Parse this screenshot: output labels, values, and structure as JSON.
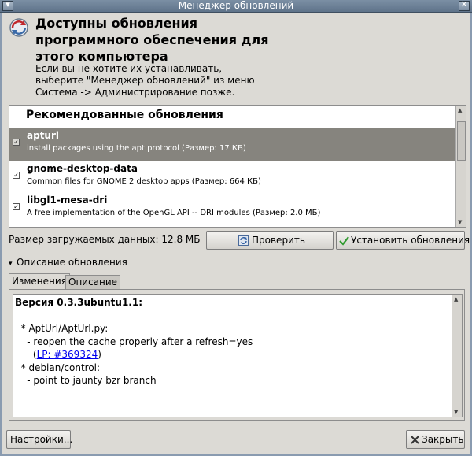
{
  "window": {
    "title": "Менеджер обновлений"
  },
  "header": {
    "title": "Доступны обновления программного обеспечения для этого компьютера",
    "description_lines": [
      "Если вы не хотите их устанавливать,",
      "выберите \"Менеджер обновлений\" из меню",
      "Система -> Администрирование позже."
    ]
  },
  "updates": {
    "section_heading": "Рекомендованные обновления",
    "items": [
      {
        "name": "apturl",
        "description": "install packages using the apt protocol (Размер: 17 КБ)",
        "checked": true,
        "selected": true
      },
      {
        "name": "gnome-desktop-data",
        "description": "Common files for GNOME 2 desktop apps (Размер: 664 КБ)",
        "checked": true,
        "selected": false
      },
      {
        "name": "libgl1-mesa-dri",
        "description": "A free implementation of the OpenGL API -- DRI modules (Размер: 2.0 МБ)",
        "checked": true,
        "selected": false
      }
    ]
  },
  "download_size": "Размер загружаемых данных: 12.8 МБ",
  "buttons": {
    "check": "Проверить",
    "install": "Установить обновления",
    "settings": "Настройки...",
    "close": "Закрыть"
  },
  "description_expander": {
    "label": "Описание обновления",
    "expanded": true
  },
  "tabs": [
    {
      "label": "Изменения",
      "active": true
    },
    {
      "label": "Описание",
      "active": false
    }
  ],
  "changes": {
    "version_line": "Версия 0.3.3ubuntu1.1:",
    "line1": "  * AptUrl/AptUrl.py:",
    "line2": "    - reopen the cache properly after a refresh=yes",
    "link_prefix": "      (",
    "link": "LP: #369324",
    "link_suffix": ")",
    "line4": "  * debian/control:",
    "line5": "    - point to jaunty bzr branch"
  },
  "colors": {
    "selected_row": "#86847e",
    "link": "#0000ee",
    "title_bar": "#6b7f95"
  }
}
